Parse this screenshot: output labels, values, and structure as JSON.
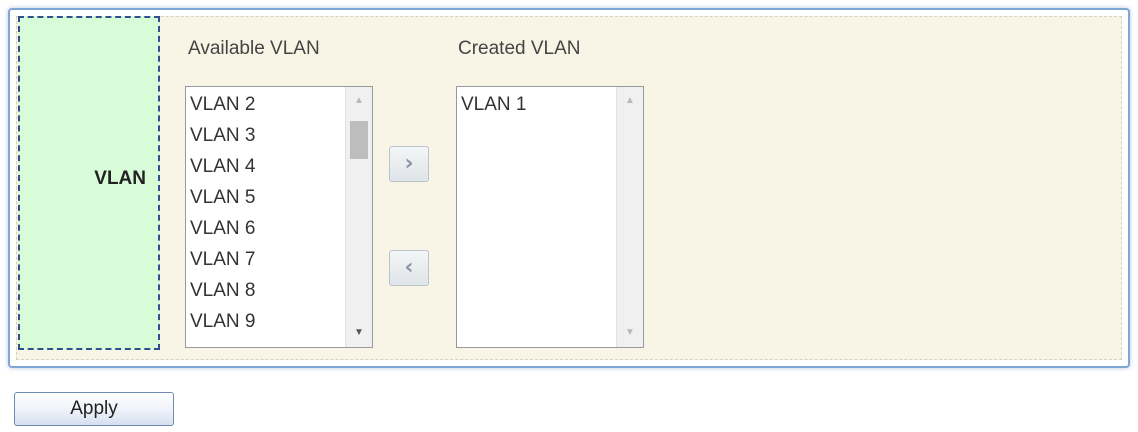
{
  "form": {
    "row_label": "VLAN"
  },
  "available": {
    "header": "Available VLAN",
    "items": [
      "VLAN 2",
      "VLAN 3",
      "VLAN 4",
      "VLAN 5",
      "VLAN 6",
      "VLAN 7",
      "VLAN 8",
      "VLAN 9"
    ]
  },
  "created": {
    "header": "Created VLAN",
    "items": [
      "VLAN 1"
    ]
  },
  "buttons": {
    "add_icon": "chevron-right-icon",
    "add_glyph": "›",
    "remove_icon": "chevron-left-icon",
    "remove_glyph": "‹",
    "apply_label": "Apply"
  },
  "icons": {
    "scroll_up_glyph": "▲",
    "scroll_down_glyph": "▼"
  },
  "colors": {
    "label_cell_bg": "#d8fbd8",
    "panel_bg": "#f8f5e6",
    "panel_border": "#7fa6d4"
  }
}
